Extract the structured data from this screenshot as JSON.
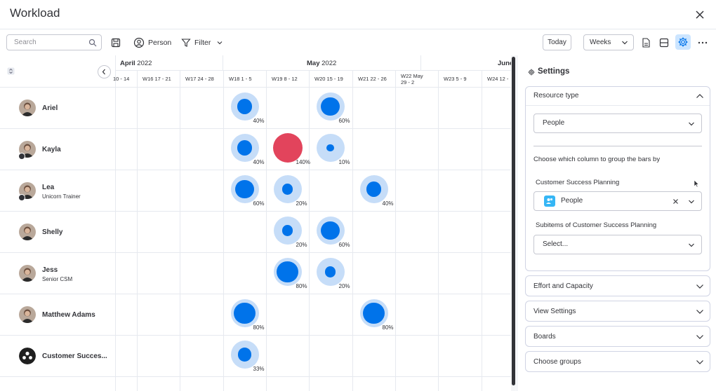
{
  "window": {
    "title": "Workload"
  },
  "toolbar": {
    "search_placeholder": "Search",
    "person_label": "Person",
    "filter_label": "Filter",
    "today_label": "Today",
    "weeks_label": "Weeks"
  },
  "timeline": {
    "months": [
      {
        "name": "April",
        "year": "2022"
      },
      {
        "name": "May",
        "year": "2022"
      },
      {
        "name": "June",
        "year": ""
      }
    ],
    "weeks": [
      "10 - 14",
      "W16  17 - 21",
      "W17  24 - 28",
      "W18  1 - 5",
      "W19  8 - 12",
      "W20  15 - 19",
      "W21  22 - 26",
      "W22  May 29 - 2",
      "W23  5 - 9",
      "W24  12 -"
    ]
  },
  "people": [
    {
      "name": "Ariel",
      "role": "",
      "status": false,
      "allocations": [
        {
          "week": 3,
          "percent": "40%",
          "level": 0.4,
          "over": false
        },
        {
          "week": 5,
          "percent": "60%",
          "level": 0.6,
          "over": false
        }
      ]
    },
    {
      "name": "Kayla",
      "role": "",
      "status": true,
      "allocations": [
        {
          "week": 3,
          "percent": "40%",
          "level": 0.4,
          "over": false
        },
        {
          "week": 4,
          "percent": "140%",
          "level": 1.4,
          "over": true
        },
        {
          "week": 5,
          "percent": "10%",
          "level": 0.1,
          "over": false
        }
      ]
    },
    {
      "name": "Lea",
      "role": "Unicorn Trainer",
      "status": true,
      "allocations": [
        {
          "week": 3,
          "percent": "60%",
          "level": 0.6,
          "over": false
        },
        {
          "week": 4,
          "percent": "20%",
          "level": 0.2,
          "over": false
        },
        {
          "week": 6,
          "percent": "40%",
          "level": 0.4,
          "over": false
        }
      ]
    },
    {
      "name": "Shelly",
      "role": "",
      "status": false,
      "allocations": [
        {
          "week": 4,
          "percent": "20%",
          "level": 0.2,
          "over": false
        },
        {
          "week": 5,
          "percent": "60%",
          "level": 0.6,
          "over": false
        }
      ]
    },
    {
      "name": "Jess",
      "role": "Senior CSM",
      "status": false,
      "allocations": [
        {
          "week": 4,
          "percent": "80%",
          "level": 0.8,
          "over": false
        },
        {
          "week": 5,
          "percent": "20%",
          "level": 0.2,
          "over": false
        }
      ]
    },
    {
      "name": "Matthew Adams",
      "role": "",
      "status": false,
      "allocations": [
        {
          "week": 3,
          "percent": "80%",
          "level": 0.8,
          "over": false
        },
        {
          "week": 6,
          "percent": "80%",
          "level": 0.8,
          "over": false
        }
      ]
    },
    {
      "name": "Customer Succes...",
      "role": "",
      "status": false,
      "allocations": [
        {
          "week": 3,
          "percent": "33%",
          "level": 0.33,
          "over": false
        }
      ]
    }
  ],
  "settings": {
    "title": "Settings",
    "resource_type": {
      "label": "Resource type",
      "value": "People",
      "group_prompt": "Choose which column to group the bars by",
      "board_label": "Customer Success Planning",
      "board_value": "People",
      "subitems_label": "Subitems of Customer Success Planning",
      "subitems_placeholder": "Select..."
    },
    "sections": [
      "Effort and Capacity",
      "View Settings",
      "Boards",
      "Choose groups"
    ]
  },
  "colors": {
    "accent": "#0073ea",
    "bubble_bg": "#c6ddf8",
    "over": "#e2445c",
    "active_bg": "#cce5ff"
  }
}
